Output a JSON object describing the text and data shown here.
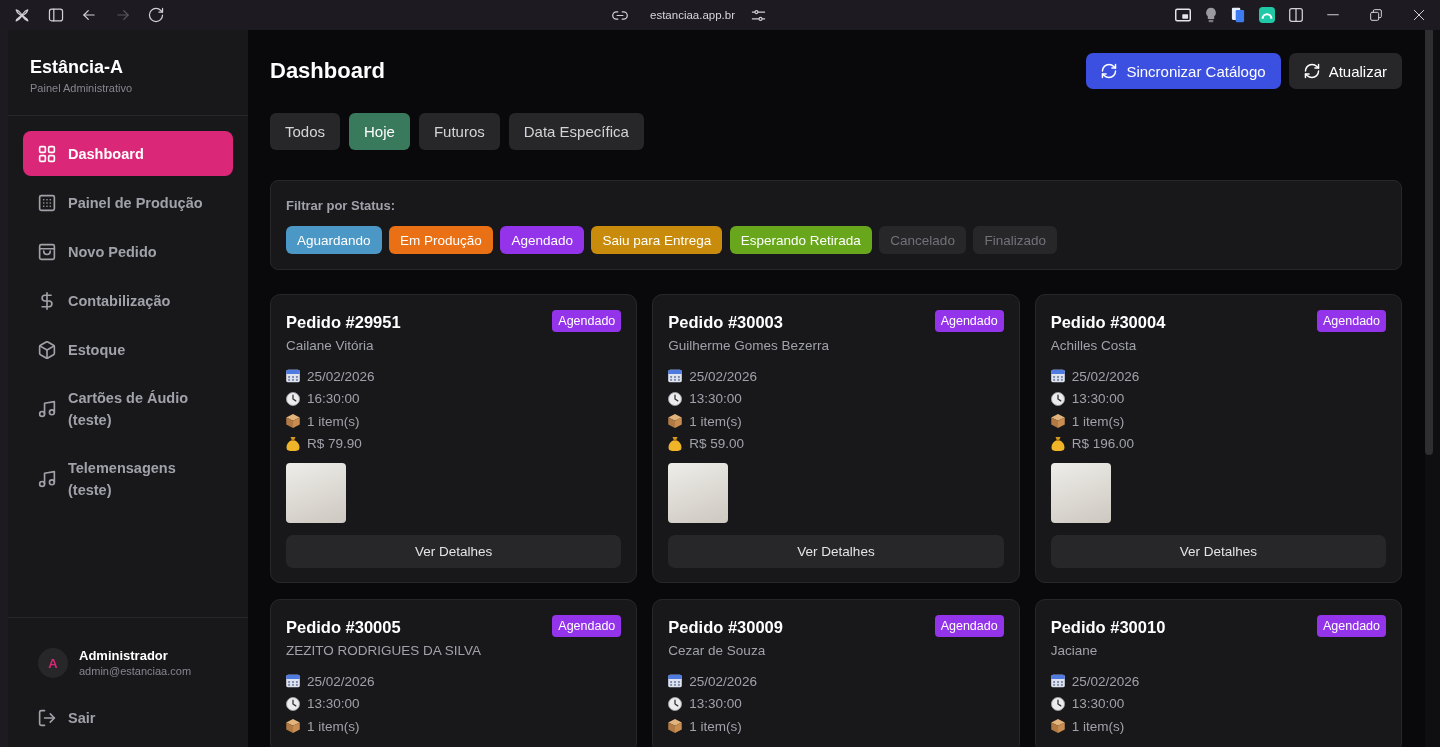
{
  "browser": {
    "url": "estanciaa.app.br",
    "forward_disabled": true
  },
  "sidebar": {
    "brand": "Estância-A",
    "subtitle": "Painel Administrativo",
    "nav": [
      {
        "label": "Dashboard",
        "kind": "grid",
        "selected": true
      },
      {
        "label": "Painel de Produção",
        "kind": "table",
        "selected": false
      },
      {
        "label": "Novo Pedido",
        "kind": "bag",
        "selected": false
      },
      {
        "label": "Contabilização",
        "kind": "dollar",
        "selected": false
      },
      {
        "label": "Estoque",
        "kind": "box",
        "selected": false
      },
      {
        "label": "Cartões de Áudio (teste)",
        "kind": "music",
        "selected": false
      },
      {
        "label": "Telemensagens (teste)",
        "kind": "music",
        "selected": false
      }
    ],
    "user": {
      "initial": "A",
      "name": "Administrador",
      "email": "admin@estanciaa.com"
    },
    "logout": "Sair"
  },
  "header": {
    "title": "Dashboard",
    "actions": [
      {
        "label": "Sincronizar Catálogo",
        "kind": "primary"
      },
      {
        "label": "Atualizar",
        "kind": "secondary"
      }
    ]
  },
  "tabs": [
    {
      "label": "Todos",
      "selected": false
    },
    {
      "label": "Hoje",
      "selected": true
    },
    {
      "label": "Futuros",
      "selected": false
    },
    {
      "label": "Data Específica",
      "selected": false
    }
  ],
  "status_filter": {
    "label": "Filtrar por Status:",
    "chips": [
      {
        "label": "Aguardando",
        "selected": true,
        "color": "#4b97c5"
      },
      {
        "label": "Em Produção",
        "selected": true,
        "color": "#ea7016"
      },
      {
        "label": "Agendado",
        "selected": true,
        "color": "#9333ea"
      },
      {
        "label": "Saiu para Entrega",
        "selected": true,
        "color": "#c98b0b"
      },
      {
        "label": "Esperando Retirada",
        "selected": true,
        "color": "#68a61c"
      },
      {
        "label": "Cancelado",
        "selected": false
      },
      {
        "label": "Finalizado",
        "selected": false
      }
    ]
  },
  "orders": [
    {
      "title": "Pedido #29951",
      "customer": "Cailane Vitória",
      "status": {
        "label": "Agendado",
        "color": "#9333ea"
      },
      "details": [
        {
          "kind": "date",
          "text": "25/02/2026"
        },
        {
          "kind": "time",
          "text": "16:30:00"
        },
        {
          "kind": "items",
          "text": "1 item(s)"
        },
        {
          "kind": "price",
          "text": "R$ 79.90"
        }
      ],
      "photo": true,
      "action": "Ver Detalhes"
    },
    {
      "title": "Pedido #30003",
      "customer": "Guilherme Gomes Bezerra",
      "status": {
        "label": "Agendado",
        "color": "#9333ea"
      },
      "details": [
        {
          "kind": "date",
          "text": "25/02/2026"
        },
        {
          "kind": "time",
          "text": "13:30:00"
        },
        {
          "kind": "items",
          "text": "1 item(s)"
        },
        {
          "kind": "price",
          "text": "R$ 59.00"
        }
      ],
      "photo": true,
      "action": "Ver Detalhes"
    },
    {
      "title": "Pedido #30004",
      "customer": "Achilles Costa",
      "status": {
        "label": "Agendado",
        "color": "#9333ea"
      },
      "details": [
        {
          "kind": "date",
          "text": "25/02/2026"
        },
        {
          "kind": "time",
          "text": "13:30:00"
        },
        {
          "kind": "items",
          "text": "1 item(s)"
        },
        {
          "kind": "price",
          "text": "R$ 196.00"
        }
      ],
      "photo": true,
      "action": "Ver Detalhes"
    },
    {
      "title": "Pedido #30005",
      "customer": "ZEZITO RODRIGUES DA SILVA",
      "status": {
        "label": "Agendado",
        "color": "#9333ea"
      },
      "details": [
        {
          "kind": "date",
          "text": "25/02/2026"
        },
        {
          "kind": "time",
          "text": "13:30:00"
        },
        {
          "kind": "items",
          "text": "1 item(s)"
        }
      ]
    },
    {
      "title": "Pedido #30009",
      "customer": "Cezar de Souza",
      "status": {
        "label": "Agendado",
        "color": "#9333ea"
      },
      "details": [
        {
          "kind": "date",
          "text": "25/02/2026"
        },
        {
          "kind": "time",
          "text": "13:30:00"
        },
        {
          "kind": "items",
          "text": "1 item(s)"
        }
      ]
    },
    {
      "title": "Pedido #30010",
      "customer": "Jaciane",
      "status": {
        "label": "Agendado",
        "color": "#9333ea"
      },
      "details": [
        {
          "kind": "date",
          "text": "25/02/2026"
        },
        {
          "kind": "time",
          "text": "13:30:00"
        },
        {
          "kind": "items",
          "text": "1 item(s)"
        }
      ]
    }
  ]
}
